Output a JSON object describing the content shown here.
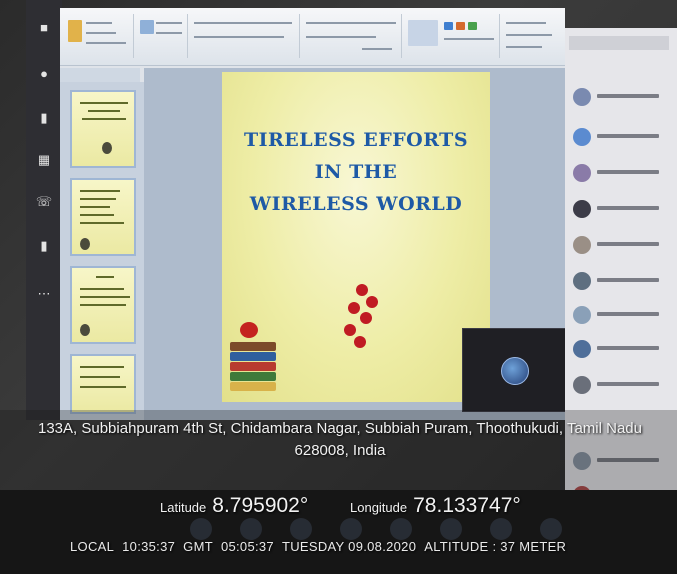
{
  "slide": {
    "title_lines": [
      "TIRELESS EFFORTS",
      "IN THE",
      "WIRELESS WORLD"
    ]
  },
  "gps": {
    "address_line1": "133A, Subbiahpuram 4th St, Chidambara Nagar, Subbiah Puram, Thoothukudi, Tamil Nadu",
    "address_line2": "628008, India",
    "latitude_label": "Latitude",
    "latitude_value": "8.795902°",
    "longitude_label": "Longitude",
    "longitude_value": "78.133747°",
    "local_label": "LOCAL",
    "local_time": "10:35:37",
    "gmt_label": "GMT",
    "gmt_time": "05:05:37",
    "date": "TUESDAY 09.08.2020",
    "altitude": "ALTITUDE : 37 METER"
  },
  "colors": {
    "slide_title": "#1e5aa6",
    "slide_bg": "#eeeda6",
    "taskbar": "#171717"
  },
  "icons": {
    "rail": [
      "activity-icon",
      "chat-icon",
      "teams-icon",
      "calendar-icon",
      "calls-icon",
      "files-icon",
      "more-icon"
    ]
  }
}
